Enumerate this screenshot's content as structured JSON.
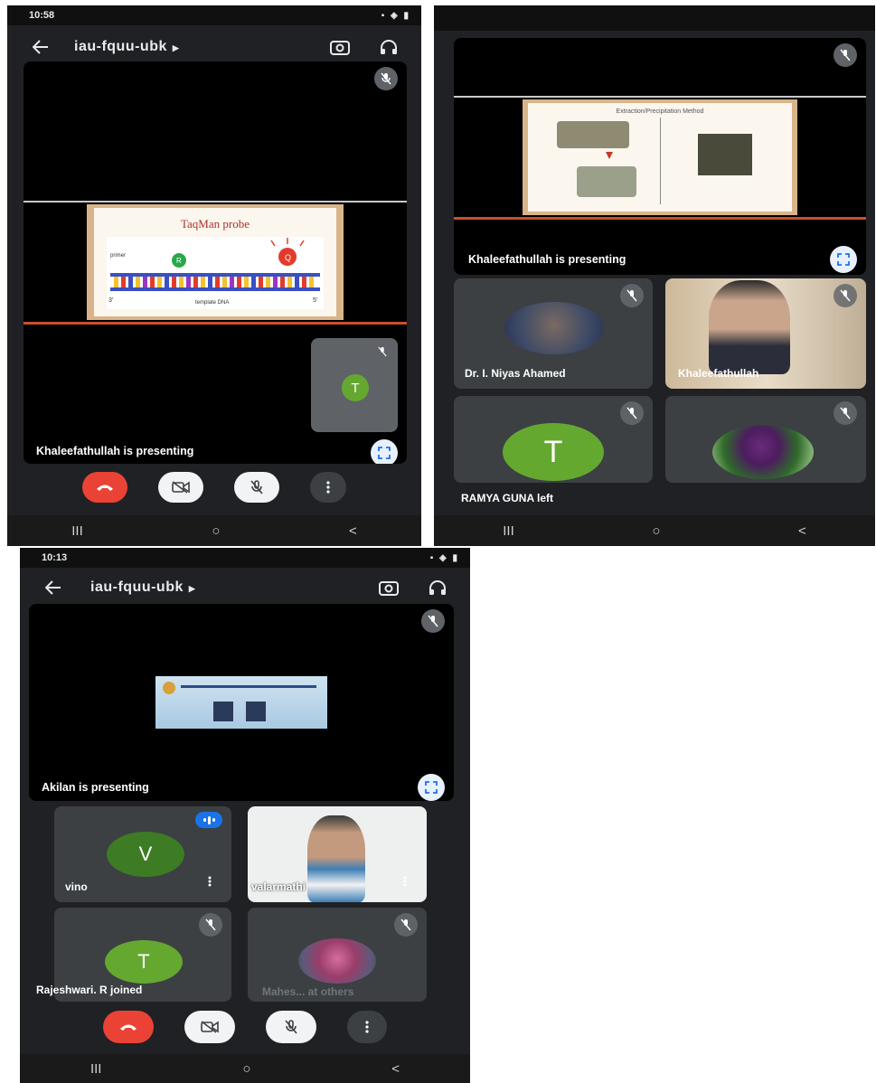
{
  "screen1": {
    "status_time": "10:58",
    "meeting_code": "iau-fquu-ubk",
    "slide_title": "TaqMan probe",
    "slide_bottom_label": "template DNA",
    "slide_label_primer": "primer",
    "strand_end_left": "3'",
    "strand_end_right": "5'",
    "pip_avatar_letter": "T",
    "presenting": "Khaleefathullah is presenting"
  },
  "screen2": {
    "slide_title": "Extraction/Precipitation Method",
    "presenting": "Khaleefathullah is presenting",
    "participants": [
      {
        "name": "Dr. I.  Niyas Ahamed"
      },
      {
        "name": "Khaleefathullah"
      },
      {
        "avatar_letter": "T"
      },
      {
        "name": ""
      }
    ],
    "event": "RAMYA GUNA left"
  },
  "screen3": {
    "status_time": "10:13",
    "meeting_code": "iau-fquu-ubk",
    "presenting": "Akilan is presenting",
    "participants": [
      {
        "name": "vino",
        "avatar_letter": "V"
      },
      {
        "name": "valarmathi"
      },
      {
        "avatar_letter": "T"
      },
      {
        "name": "Mahes... at others"
      }
    ],
    "event": "Rajeshwari. R joined"
  },
  "nav": {
    "recents": "III",
    "home": "○",
    "back": "<"
  },
  "colors": {
    "end_call": "#ea4335",
    "avatar_green": "#65a830",
    "avatar_dark_green": "#3d7b25",
    "tile": "#3c4043",
    "speaking_blue": "#1a73e8"
  },
  "icons": [
    "back-arrow-icon",
    "camera-flip-icon",
    "headphones-icon",
    "mic-off-icon",
    "fullscreen-icon",
    "end-call-icon",
    "camera-off-icon",
    "more-vert-icon"
  ]
}
